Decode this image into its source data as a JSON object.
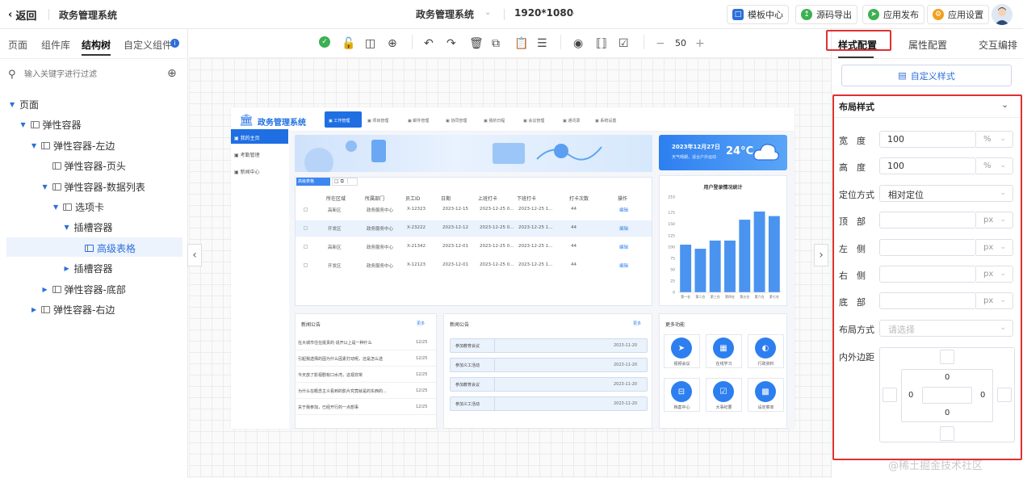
{
  "topbar": {
    "back_label": "返回",
    "project_name": "政务管理系统",
    "page_selector": "政务管理系统",
    "resolution": "1920*1080",
    "buttons": [
      {
        "label": "模板中心",
        "color": "#2d6fd8"
      },
      {
        "label": "源码导出",
        "color": "#3db052"
      },
      {
        "label": "应用发布",
        "color": "#3db052"
      },
      {
        "label": "应用设置",
        "color": "#f0a020"
      }
    ]
  },
  "left": {
    "tabs": [
      "页面",
      "组件库",
      "结构树",
      "自定义组件"
    ],
    "active_tab": "结构树",
    "search_placeholder": "输入关键字进行过滤",
    "tree": [
      {
        "label": "页面",
        "depth": 0,
        "expanded": true,
        "icon": false
      },
      {
        "label": "弹性容器",
        "depth": 1,
        "expanded": true,
        "icon": true
      },
      {
        "label": "弹性容器-左边",
        "depth": 2,
        "expanded": true,
        "icon": true
      },
      {
        "label": "弹性容器-页头",
        "depth": 3,
        "leaf": true,
        "icon": true
      },
      {
        "label": "弹性容器-数据列表",
        "depth": 3,
        "expanded": true,
        "icon": true
      },
      {
        "label": "选项卡",
        "depth": 4,
        "expanded": true,
        "icon": true
      },
      {
        "label": "插槽容器",
        "depth": 5,
        "expanded": true,
        "icon": false
      },
      {
        "label": "高级表格",
        "depth": 6,
        "leaf": true,
        "icon": true,
        "selected": true
      },
      {
        "label": "插槽容器",
        "depth": 5,
        "expanded": false,
        "icon": false
      },
      {
        "label": "弹性容器-底部",
        "depth": 3,
        "expanded": false,
        "icon": true
      },
      {
        "label": "弹性容器-右边",
        "depth": 2,
        "expanded": false,
        "icon": true
      }
    ]
  },
  "toolbar": {
    "zoom": "50"
  },
  "design": {
    "title": "政务管理系统",
    "nav": [
      "工作管理",
      "项目管理",
      "邮件管理",
      "协同管理",
      "我的日程",
      "会议管理",
      "通讯录",
      "系统设置"
    ],
    "side": [
      "我的主页",
      "考勤管理",
      "新闻中心"
    ],
    "table_tag": "高级表格_table_1",
    "table_headers": [
      "所在区域",
      "所属部门",
      "员工ID",
      "日期",
      "上班打卡",
      "下班打卡",
      "打卡次数",
      "操作"
    ],
    "table_rows": [
      [
        "高新区",
        "政务服务中心",
        "X-12323",
        "2023-12-15",
        "2023-12-25 0...",
        "2023-12-25 1...",
        "44",
        "编辑"
      ],
      [
        "开发区",
        "政务服务中心",
        "X-23222",
        "2023-12-12",
        "2023-12-25 0...",
        "2023-12-25 1...",
        "44",
        "编辑"
      ],
      [
        "高新区",
        "政务服务中心",
        "X-21342",
        "2023-12-01",
        "2023-12-25 0...",
        "2023-12-25 1...",
        "44",
        "编辑"
      ],
      [
        "开发区",
        "政务服务中心",
        "X-12123",
        "2023-12-01",
        "2023-12-25 0...",
        "2023-12-25 1...",
        "44",
        "编辑"
      ]
    ],
    "weather_date": "2023年12月27日",
    "weather_desc": "天气晴朗，适合户外运动",
    "weather_temp": "24°C",
    "news_title_a": "新闻公告",
    "news_more_a": "更多",
    "news_a": [
      {
        "text": "在大城市住在挺贵的 说开以上是一种什么",
        "date": "12/25"
      },
      {
        "text": "引起我选择的因为什么因素打动呢，还是怎么选",
        "date": "12/25"
      },
      {
        "text": "今天放了影视剧有口水湾，这视非常",
        "date": "12/25"
      },
      {
        "text": "为什么在概念主义看到的影片究竟就是的东西的...",
        "date": "12/25"
      },
      {
        "text": "关于我参加，已经开行的一点想事",
        "date": "12/25"
      }
    ],
    "news_title_b": "新闻公告",
    "news_more_b": "更多",
    "news_b": [
      {
        "text": "参加教育会议",
        "date": "2023-11-20"
      },
      {
        "text": "参加义工活动",
        "date": "2023-11-20"
      },
      {
        "text": "参加教育会议",
        "date": "2023-11-20"
      },
      {
        "text": "参加义工活动",
        "date": "2023-11-20"
      }
    ],
    "more_title": "更多功能",
    "more_items": [
      "视频会议",
      "在线学习",
      "行政资料",
      "档案中心",
      "大事纪要",
      "设定菜单"
    ]
  },
  "chart_data": {
    "type": "bar",
    "title": "用户登录情况统计",
    "categories": [
      "第一仓",
      "第二仓",
      "第三仓",
      "第四仓",
      "第五仓",
      "第六仓",
      "第七仓"
    ],
    "values": [
      105,
      96,
      114,
      114,
      160,
      178,
      168
    ],
    "ylim": [
      0,
      210
    ],
    "yticks": [
      0,
      25,
      50,
      75,
      100,
      125,
      150,
      175,
      210
    ],
    "color": "#4a94f0"
  },
  "right": {
    "tabs": [
      "样式配置",
      "属性配置",
      "交互编排"
    ],
    "active_tab": "样式配置",
    "custom_style_btn": "自定义样式",
    "section_title": "布局样式",
    "props": [
      {
        "label": "宽　度",
        "value": "100",
        "unit": "%"
      },
      {
        "label": "高　度",
        "value": "100",
        "unit": "%"
      },
      {
        "label": "定位方式",
        "select": "相对定位"
      },
      {
        "label": "顶　部",
        "value": "",
        "unit": "px"
      },
      {
        "label": "左　侧",
        "value": "",
        "unit": "px"
      },
      {
        "label": "右　侧",
        "value": "",
        "unit": "px"
      },
      {
        "label": "底　部",
        "value": "",
        "unit": "px"
      },
      {
        "label": "布局方式",
        "select_placeholder": "请选择"
      }
    ],
    "boxmodel_label": "内外边距",
    "boxmodel_values": [
      "0",
      "0",
      "0",
      "0"
    ]
  },
  "watermark": "@稀土掘金技术社区"
}
